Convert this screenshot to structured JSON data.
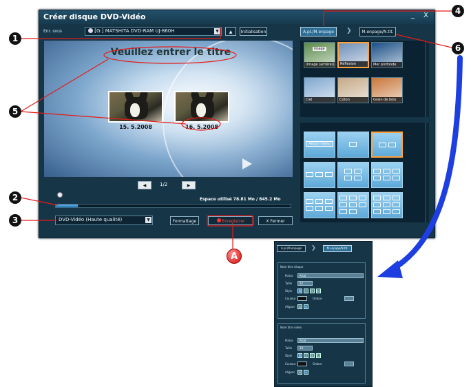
{
  "window": {
    "title": "Créer disque DVD-Vidéo",
    "minimize": "_",
    "close": "X"
  },
  "toolbar": {
    "save_label": "Enr. sous",
    "drive_value": "[G:] MATSHITA DVD-RAM UJ-860H",
    "eject_symbol": "▲",
    "init_label": "Initialisation"
  },
  "tabs": [
    {
      "label": "A.pl./M.enpage",
      "selected": true
    },
    {
      "label": "M.enpage/N.tit.",
      "selected": false
    }
  ],
  "tab_separator": "❯",
  "preview": {
    "title": "Veuillez entrer le titre",
    "dates": [
      "15. 5.2008",
      "16. 5.2008"
    ]
  },
  "pager": {
    "prev": "◀",
    "value": "1/2",
    "next": "▶"
  },
  "space": {
    "text": "Espace utilisé  78.81 Mo / 845.2 Mo",
    "used": 78.81,
    "total": 845.2
  },
  "format": {
    "value": "DVD-Vidéo (Haute qualité)"
  },
  "buttons": {
    "format": "Formattage",
    "record": "Enregistrer",
    "close": "Fermer",
    "close_symbol": "X"
  },
  "backgrounds": [
    {
      "label": "(Image (arrière))",
      "sel": false,
      "color": "#5b8a4a"
    },
    {
      "label": "Réflexion",
      "sel": true,
      "color": "#6f8fb8"
    },
    {
      "label": "Mer profonde",
      "sel": false,
      "color": "#1b4f86"
    },
    {
      "label": "Ciel",
      "sel": false,
      "color": "#7ea6cf"
    },
    {
      "label": "Coton",
      "sel": false,
      "color": "#c4a986"
    },
    {
      "label": "Grain de bois",
      "sel": false,
      "color": "#c8773a"
    }
  ],
  "bg_badge": "image",
  "layouts": {
    "none_label": "Aucun menu"
  },
  "callouts": [
    "1",
    "2",
    "3",
    "4",
    "5",
    "6"
  ],
  "callout_A": "A",
  "subpanel": {
    "tabs": [
      "A.pl./M.enpage",
      "M.enpage/N.tit."
    ],
    "group1": "Nom titre disque",
    "group2": "Nom titre vidéo",
    "police": "Police",
    "taille": "Taille",
    "style": "Style",
    "couleur": "Couleur",
    "ombre": "Ombre",
    "aligner": "Aligner",
    "font1": "Arial",
    "size1": "22",
    "font2": "Arial",
    "size2": "14",
    "style_buttons": [
      "B",
      "I",
      "S",
      "U"
    ],
    "align_buttons": [
      "≡",
      "≡"
    ]
  }
}
